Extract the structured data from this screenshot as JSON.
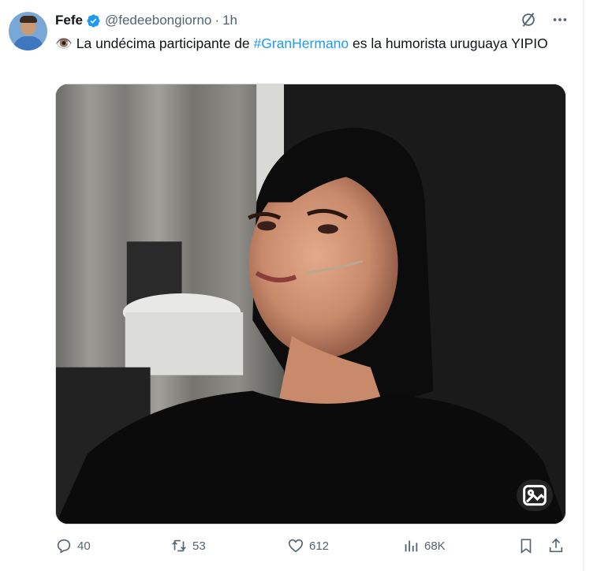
{
  "author": {
    "display_name": "Fefe",
    "handle": "@fedeebongiorno",
    "separator": "·",
    "time": "1h"
  },
  "tweet": {
    "emoji": "👁️",
    "text_before": "La undécima participante de ",
    "hashtag": "#GranHermano",
    "text_after": " es la humorista uruguaya YIPIO"
  },
  "stats": {
    "replies": "40",
    "retweets": "53",
    "likes": "612",
    "views": "68K"
  },
  "colors": {
    "accent": "#1d9bf0",
    "muted": "#536471",
    "text": "#0f1419"
  },
  "icons": [
    "verified-badge-icon",
    "grok-icon",
    "more-icon",
    "reply-icon",
    "retweet-icon",
    "like-icon",
    "views-icon",
    "bookmark-icon",
    "share-icon",
    "alt-text-icon"
  ]
}
